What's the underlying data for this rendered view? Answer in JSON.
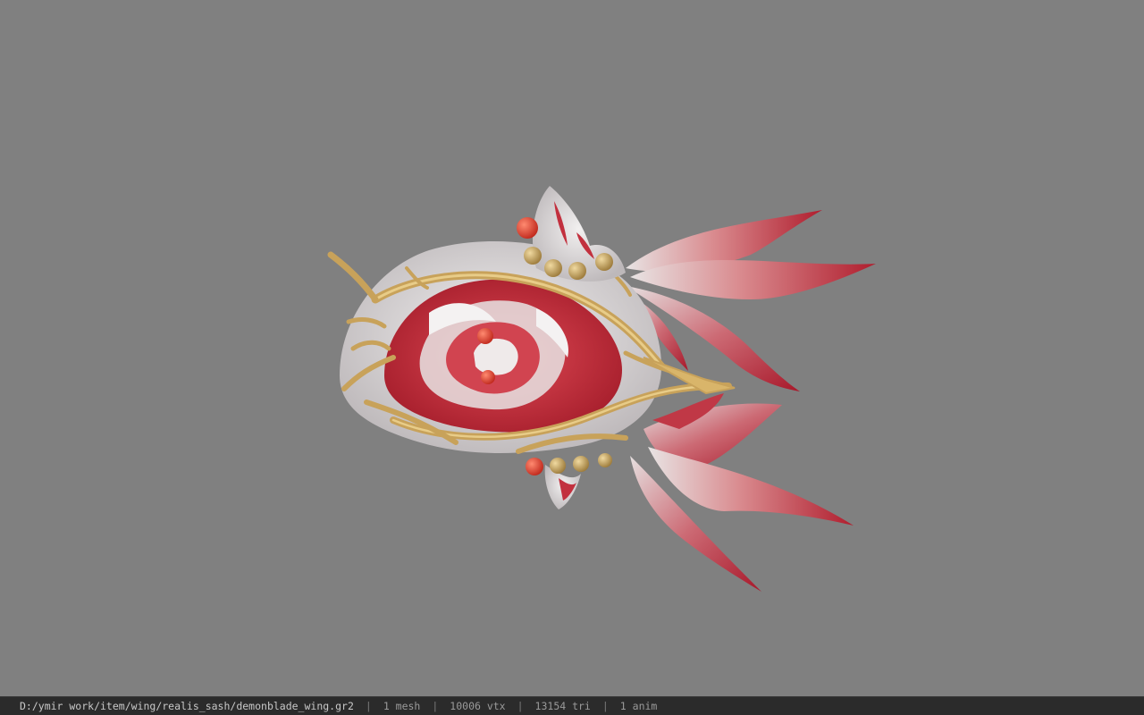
{
  "viewer": {
    "background_color": "#808080",
    "model_icon": "model-preview-icon"
  },
  "status": {
    "file_path": "D:/ymir work/item/wing/realis_sash/demonblade_wing.gr2",
    "separator": "|",
    "mesh_count": "1 mesh",
    "vertex_count": "10006 vtx",
    "triangle_count": "13154 tri",
    "anim_count": "1 anim"
  }
}
